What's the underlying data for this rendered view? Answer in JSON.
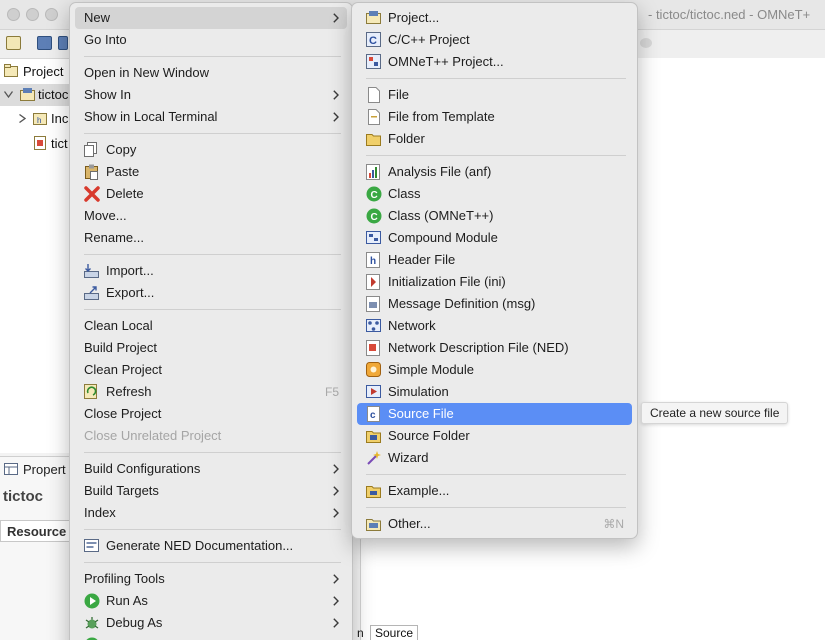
{
  "window": {
    "title": "- tictoc/tictoc.ned - OMNeT+"
  },
  "project_explorer": {
    "tab_label": "Project",
    "tree": [
      {
        "label": "tictoc",
        "icon": "project-folder-icon"
      },
      {
        "label": "Inc",
        "icon": "includes-icon"
      },
      {
        "label": "tict",
        "icon": "ned-file-icon"
      }
    ]
  },
  "properties": {
    "tab_label": "Propert",
    "title": "tictoc",
    "resource_tab": "Resource"
  },
  "bottom_tabs": {
    "pre": "n",
    "source": "Source"
  },
  "context_menu": {
    "items": [
      {
        "label": "New",
        "submenu": true,
        "highlight": true
      },
      {
        "label": "Go Into"
      },
      {
        "sep": true
      },
      {
        "label": "Open in New Window"
      },
      {
        "label": "Show In",
        "submenu": true
      },
      {
        "label": "Show in Local Terminal",
        "submenu": true
      },
      {
        "sep": true
      },
      {
        "label": "Copy",
        "icon": "copy-icon"
      },
      {
        "label": "Paste",
        "icon": "paste-icon"
      },
      {
        "label": "Delete",
        "icon": "delete-icon"
      },
      {
        "label": "Move..."
      },
      {
        "label": "Rename..."
      },
      {
        "sep": true
      },
      {
        "label": "Import...",
        "icon": "import-icon"
      },
      {
        "label": "Export...",
        "icon": "export-icon"
      },
      {
        "sep": true
      },
      {
        "label": "Clean Local"
      },
      {
        "label": "Build Project"
      },
      {
        "label": "Clean Project"
      },
      {
        "label": "Refresh",
        "icon": "refresh-icon",
        "shortcut": "F5"
      },
      {
        "label": "Close Project"
      },
      {
        "label": "Close Unrelated Project",
        "disabled": true
      },
      {
        "sep": true
      },
      {
        "label": "Build Configurations",
        "submenu": true
      },
      {
        "label": "Build Targets",
        "submenu": true
      },
      {
        "label": "Index",
        "submenu": true
      },
      {
        "sep": true
      },
      {
        "label": "Generate NED Documentation...",
        "icon": "documentation-icon"
      },
      {
        "sep": true
      },
      {
        "label": "Profiling Tools",
        "submenu": true
      },
      {
        "label": "Run As",
        "icon": "run-icon",
        "submenu": true
      },
      {
        "label": "Debug As",
        "icon": "debug-icon",
        "submenu": true
      },
      {
        "label": "",
        "icon": "profile-icon",
        "submenu": true
      }
    ]
  },
  "new_submenu": {
    "items": [
      {
        "label": "Project...",
        "icon": "project-icon"
      },
      {
        "label": "C/C++ Project",
        "icon": "cpp-project-icon"
      },
      {
        "label": "OMNeT++ Project...",
        "icon": "omnet-project-icon"
      },
      {
        "sep": true
      },
      {
        "label": "File",
        "icon": "file-icon"
      },
      {
        "label": "File from Template",
        "icon": "file-template-icon"
      },
      {
        "label": "Folder",
        "icon": "folder-icon"
      },
      {
        "sep": true
      },
      {
        "label": "Analysis File (anf)",
        "icon": "analysis-file-icon"
      },
      {
        "label": "Class",
        "icon": "class-icon"
      },
      {
        "label": "Class (OMNeT++)",
        "icon": "class-omnet-icon"
      },
      {
        "label": "Compound Module",
        "icon": "compound-module-icon"
      },
      {
        "label": "Header File",
        "icon": "header-file-icon"
      },
      {
        "label": "Initialization File (ini)",
        "icon": "ini-file-icon"
      },
      {
        "label": "Message Definition (msg)",
        "icon": "msg-definition-icon"
      },
      {
        "label": "Network",
        "icon": "network-icon"
      },
      {
        "label": "Network Description File (NED)",
        "icon": "ned-file-icon"
      },
      {
        "label": "Simple Module",
        "icon": "simple-module-icon"
      },
      {
        "label": "Simulation",
        "icon": "simulation-icon"
      },
      {
        "label": "Source File",
        "icon": "source-file-icon",
        "selected": true
      },
      {
        "label": "Source Folder",
        "icon": "source-folder-icon"
      },
      {
        "label": "Wizard",
        "icon": "wizard-icon"
      },
      {
        "sep": true
      },
      {
        "label": "Example...",
        "icon": "example-icon"
      },
      {
        "sep": true
      },
      {
        "label": "Other...",
        "icon": "other-icon",
        "shortcut": "⌘N"
      }
    ]
  },
  "tooltip": {
    "text": "Create a new source file"
  },
  "colors": {
    "selection": "#5b8ef5",
    "hover": "#d4d4d4",
    "menu_bg": "#ebebeb"
  }
}
